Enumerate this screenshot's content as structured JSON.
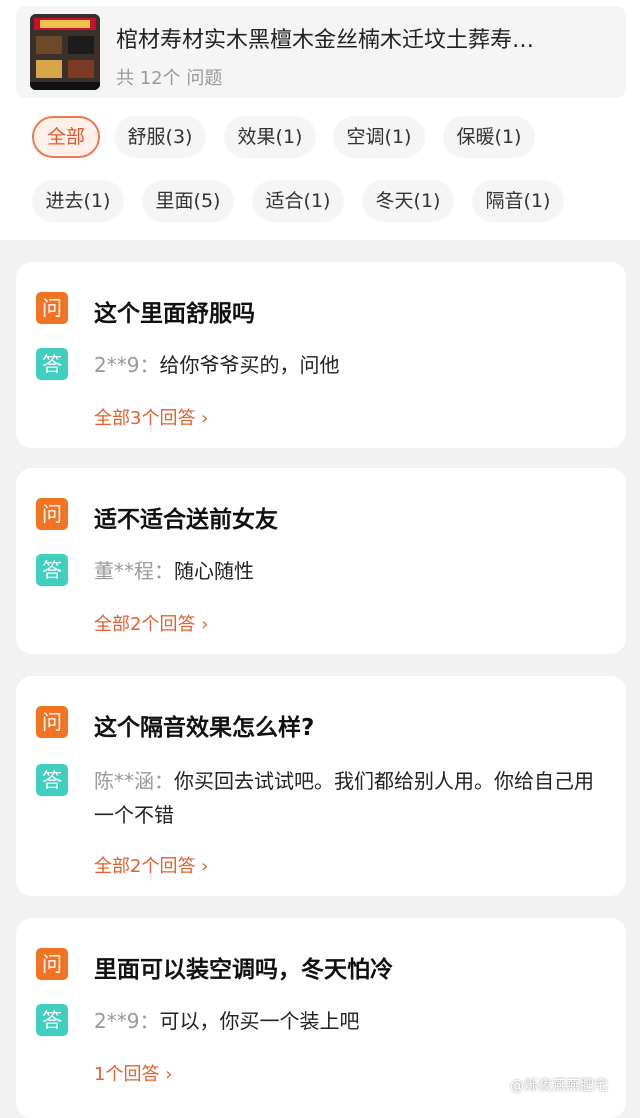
{
  "product": {
    "title": "棺材寿材实木黑檀木金丝楠木迁坟土葬寿…",
    "subtitle": "共 12个 问题"
  },
  "filters": [
    {
      "label": "全部",
      "active": true
    },
    {
      "label": "舒服(3)"
    },
    {
      "label": "效果(1)"
    },
    {
      "label": "空调(1)"
    },
    {
      "label": "保暖(1)"
    },
    {
      "label": "进去(1)"
    },
    {
      "label": "里面(5)"
    },
    {
      "label": "适合(1)"
    },
    {
      "label": "冬天(1)"
    },
    {
      "label": "隔音(1)"
    }
  ],
  "tags": {
    "question": "问",
    "answer": "答"
  },
  "qa": [
    {
      "question": "这个里面舒服吗",
      "user": "2**9：",
      "answer": "给你爷爷买的，问他",
      "more": "全部3个回答"
    },
    {
      "question": "适不适合送前女友",
      "user": "董**程：",
      "answer": "随心随性",
      "more": "全部2个回答"
    },
    {
      "question": "这个隔音效果怎么样?",
      "user": "陈**涵：",
      "answer": "你买回去试试吧。我们都给别人用。你给自己用一个不错",
      "more": "全部2个回答"
    },
    {
      "question": "里面可以装空调吗，冬天怕冷",
      "user": "2**9：",
      "answer": "可以，你买一个装上吧",
      "more": "1个回答"
    }
  ],
  "watermark": "@烁夜燕燕肥宅",
  "colors": {
    "accent": "#e4572e",
    "question_tag": "#f27322",
    "answer_tag": "#3fcfbf"
  }
}
